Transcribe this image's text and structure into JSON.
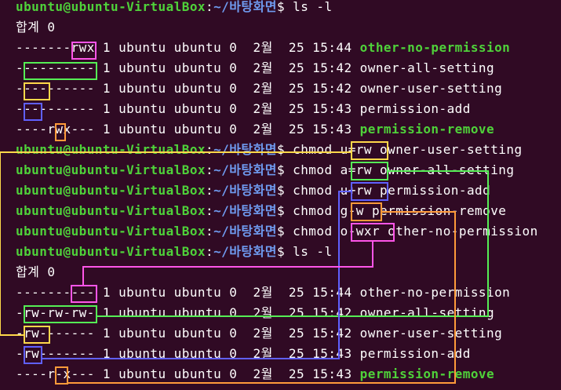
{
  "prompt": {
    "user": "ubuntu@ubuntu-VirtualBox",
    "sep": ":",
    "path": "~/바탕화면",
    "symbol": "$"
  },
  "lines": [
    {
      "type": "cmd",
      "command": " ls -l"
    },
    {
      "type": "out",
      "text": "합계 0"
    },
    {
      "type": "file",
      "meta": "-------rwx 1 ubuntu ubuntu 0  2월  25 15:44 ",
      "name": "other-no-permission",
      "exec": true
    },
    {
      "type": "file",
      "meta": "---------- 1 ubuntu ubuntu 0  2월  25 15:42 ",
      "name": "owner-all-setting",
      "exec": false
    },
    {
      "type": "file",
      "meta": "---------- 1 ubuntu ubuntu 0  2월  25 15:42 ",
      "name": "owner-user-setting",
      "exec": false
    },
    {
      "type": "file",
      "meta": "---------- 1 ubuntu ubuntu 0  2월  25 15:43 ",
      "name": "permission-add",
      "exec": false
    },
    {
      "type": "file",
      "meta": "----rwx--- 1 ubuntu ubuntu 0  2월  25 15:43 ",
      "name": "permission-remove",
      "exec": true
    },
    {
      "type": "cmd",
      "command": " chmod u=rw owner-user-setting"
    },
    {
      "type": "cmd",
      "command": " chmod a=rw owner-all-setting"
    },
    {
      "type": "cmd",
      "command": " chmod u+rw permission-add"
    },
    {
      "type": "cmd",
      "command": " chmod g-w permission-remove"
    },
    {
      "type": "cmd",
      "command": " chmod o-wxr other-no-permission"
    },
    {
      "type": "cmd",
      "command": " ls -l"
    },
    {
      "type": "out",
      "text": "합계 0"
    },
    {
      "type": "file",
      "meta": "---------- 1 ubuntu ubuntu 0  2월  25 15:44 ",
      "name": "other-no-permission",
      "exec": false
    },
    {
      "type": "file",
      "meta": "-rw-rw-rw- 1 ubuntu ubuntu 0  2월  25 15:42 ",
      "name": "owner-all-setting",
      "exec": false
    },
    {
      "type": "file",
      "meta": "-rw------- 1 ubuntu ubuntu 0  2월  25 15:42 ",
      "name": "owner-user-setting",
      "exec": false
    },
    {
      "type": "file",
      "meta": "-rw------- 1 ubuntu ubuntu 0  2월  25 15:43 ",
      "name": "permission-add",
      "exec": false
    },
    {
      "type": "file",
      "meta": "----r-x--- 1 ubuntu ubuntu 0  2월  25 15:43 ",
      "name": "permission-remove",
      "exec": true
    }
  ],
  "colors": {
    "background": "#300a24",
    "user": "#4fd23a",
    "path": "#6f9bf0",
    "text": "#ffffff",
    "annotations": {
      "pink": "#ff55e8",
      "green": "#55ee55",
      "yellow": "#ffd84a",
      "blue": "#6060ff",
      "orange": "#ff9a3a"
    }
  }
}
